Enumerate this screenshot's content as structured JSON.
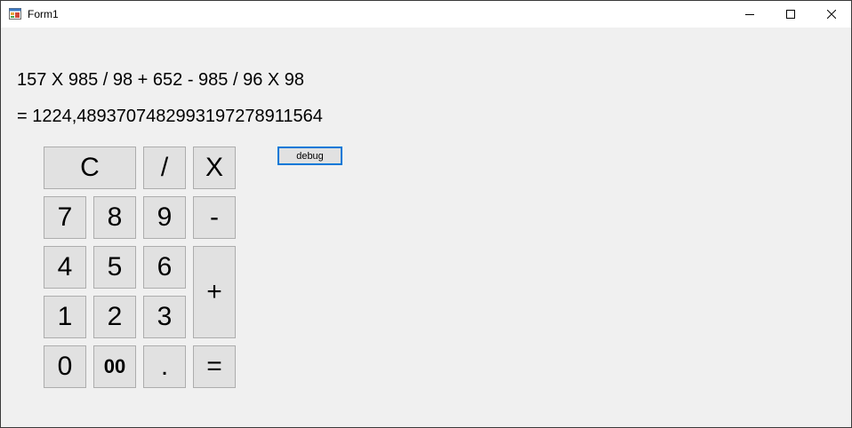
{
  "window": {
    "title": "Form1",
    "controls": {
      "minimize_icon": "minimize-icon",
      "maximize_icon": "maximize-icon",
      "close_icon": "close-icon"
    }
  },
  "display": {
    "expression": "157 X 985 / 98 + 652 - 985 / 96 X 98",
    "result": "= 1224,48937074829931972789115​64"
  },
  "keypad": {
    "clear": "C",
    "divide": "/",
    "multiply": "X",
    "seven": "7",
    "eight": "8",
    "nine": "9",
    "minus": "-",
    "four": "4",
    "five": "5",
    "six": "6",
    "plus": "+",
    "one": "1",
    "two": "2",
    "three": "3",
    "zero": "0",
    "double_zero": "00",
    "decimal": ".",
    "equals": "="
  },
  "debug_button": {
    "label": "debug"
  },
  "colors": {
    "button_face": "#e1e1e1",
    "button_border": "#adadad",
    "focus_border": "#0078d7",
    "client_bg": "#f0f0f0"
  }
}
